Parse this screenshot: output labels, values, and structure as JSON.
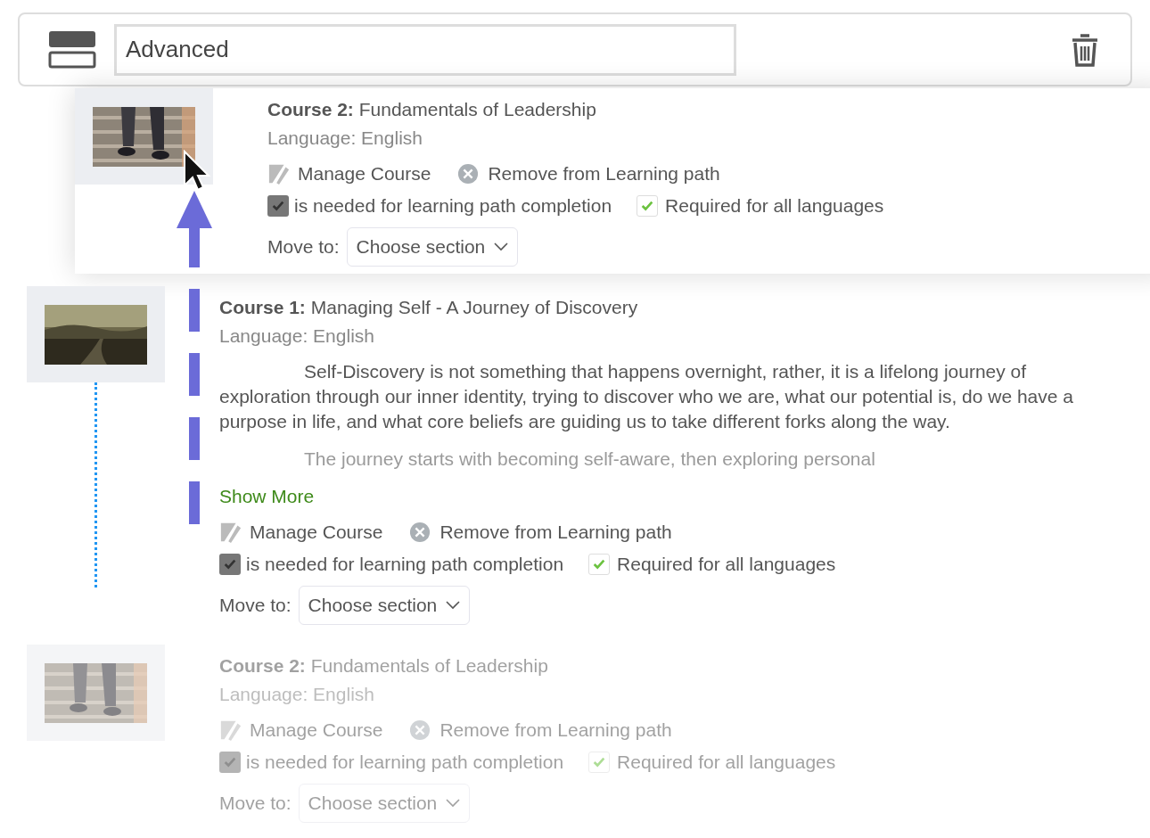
{
  "header": {
    "value": "Advanced"
  },
  "courses": [
    {
      "label": "Course 1:",
      "title": "Managing Self - A Journey of Discovery",
      "language": "Language: English",
      "dimmed": false,
      "description": [
        "Self-Discovery is not something that happens overnight, rather, it is a lifelong journey of exploration through our inner identity, trying to discover who we are, what our potential is, do we have a purpose in life, and what core beliefs are guiding us to take different forks along the way.",
        "The journey starts with becoming self-aware, then exploring personal"
      ],
      "show_more": "Show More",
      "manage": "Manage Course",
      "remove": "Remove from Learning path",
      "needed": {
        "label": "is needed for learning path completion",
        "checked": true
      },
      "required_all": {
        "label": "Required for all languages",
        "checked": true
      },
      "move_label": "Move to:",
      "move_value": "Choose section"
    },
    {
      "label": "Course 2:",
      "title": "Fundamentals of Leadership",
      "language": "Language: English",
      "dimmed": true,
      "manage": "Manage Course",
      "remove": "Remove from Learning path",
      "needed": {
        "label": "is needed for learning path completion",
        "checked": true
      },
      "required_all": {
        "label": "Required for all languages",
        "checked": true
      },
      "move_label": "Move to:",
      "move_value": "Choose section"
    }
  ],
  "drag_preview": {
    "label": "Course 2:",
    "title": "Fundamentals of Leadership",
    "language": "Language: English",
    "dimmed": false,
    "manage": "Manage Course",
    "remove": "Remove from Learning path",
    "needed": {
      "label": "is needed for learning path completion",
      "checked": true
    },
    "required_all": {
      "label": "Required for all languages",
      "checked": true
    },
    "move_label": "Move to:",
    "move_value": "Choose section"
  }
}
